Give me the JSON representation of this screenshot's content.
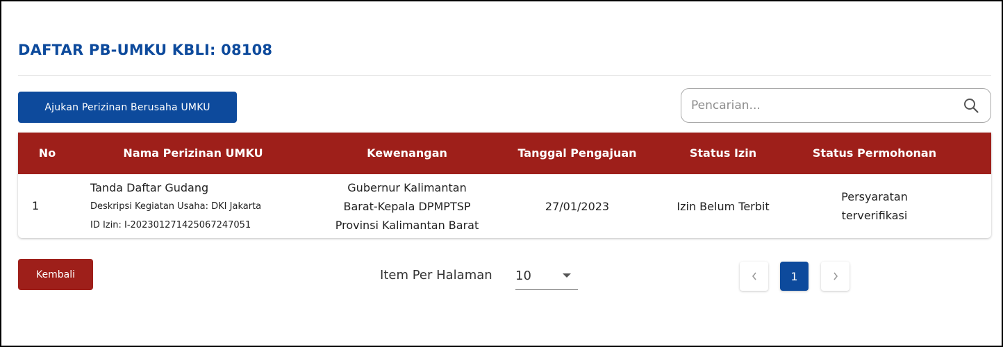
{
  "page": {
    "title": "DAFTAR PB-UMKU KBLI: 08108"
  },
  "toolbar": {
    "submit_label": "Ajukan Perizinan Berusaha UMKU",
    "search_placeholder": "Pencarian..."
  },
  "table": {
    "headers": {
      "no": "No",
      "nama": "Nama Perizinan UMKU",
      "kewenangan": "Kewenangan",
      "tanggal": "Tanggal Pengajuan",
      "status_izin": "Status Izin",
      "status_permohonan": "Status Permohonan"
    },
    "rows": [
      {
        "no": "1",
        "nama": "Tanda Daftar Gudang",
        "deskripsi": "Deskripsi Kegiatan Usaha: DKI Jakarta",
        "id_izin": "ID Izin: I-202301271425067247051",
        "kewenangan_line1": "Gubernur Kalimantan",
        "kewenangan_line2": "Barat-Kepala DPMPTSP",
        "kewenangan_line3": "Provinsi Kalimantan Barat",
        "tanggal": "27/01/2023",
        "status_izin": "Izin Belum Terbit",
        "status_permohonan_line1": "Persyaratan",
        "status_permohonan_line2": "terverifikasi"
      }
    ]
  },
  "footer": {
    "back_label": "Kembali",
    "per_page_label": "Item Per Halaman",
    "per_page_value": "10",
    "current_page": "1"
  },
  "colors": {
    "primary": "#0d4a9c",
    "header_bg": "#9e1f1a",
    "back_button": "#9e1f1a"
  },
  "icons": {
    "search": "search-icon",
    "dropdown": "chevron-down-icon",
    "prev": "chevron-left-icon",
    "next": "chevron-right-icon"
  }
}
